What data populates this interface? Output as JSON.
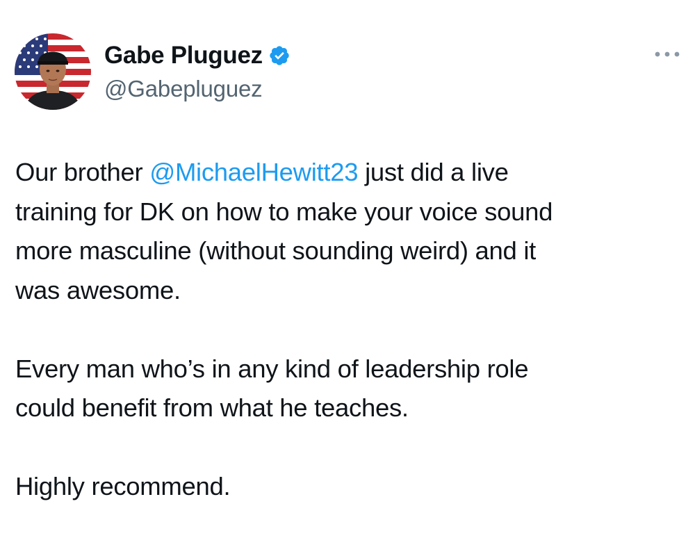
{
  "author": {
    "display_name": "Gabe Pluguez",
    "handle": "@Gabepluguez",
    "verified": true,
    "avatar_icon": "avatar-flag-photo"
  },
  "icons": {
    "verified": "verified-badge-icon",
    "more": "more-options-icon"
  },
  "colors": {
    "text": "#0f1419",
    "secondary": "#536471",
    "accent": "#1d9bf0"
  },
  "tweet": {
    "p1_before": "Our brother ",
    "p1_mention": "@MichaelHewitt23",
    "p1_line1_after": " just did a live",
    "p1_line2": "training for DK on how to make your voice sound",
    "p1_line3": "more masculine (without sounding weird) and it",
    "p1_line4": "was awesome.",
    "p2_line1": "Every man who’s in any kind of leadership role",
    "p2_line2": "could benefit from what he teaches.",
    "p3_line1": "Highly recommend."
  }
}
